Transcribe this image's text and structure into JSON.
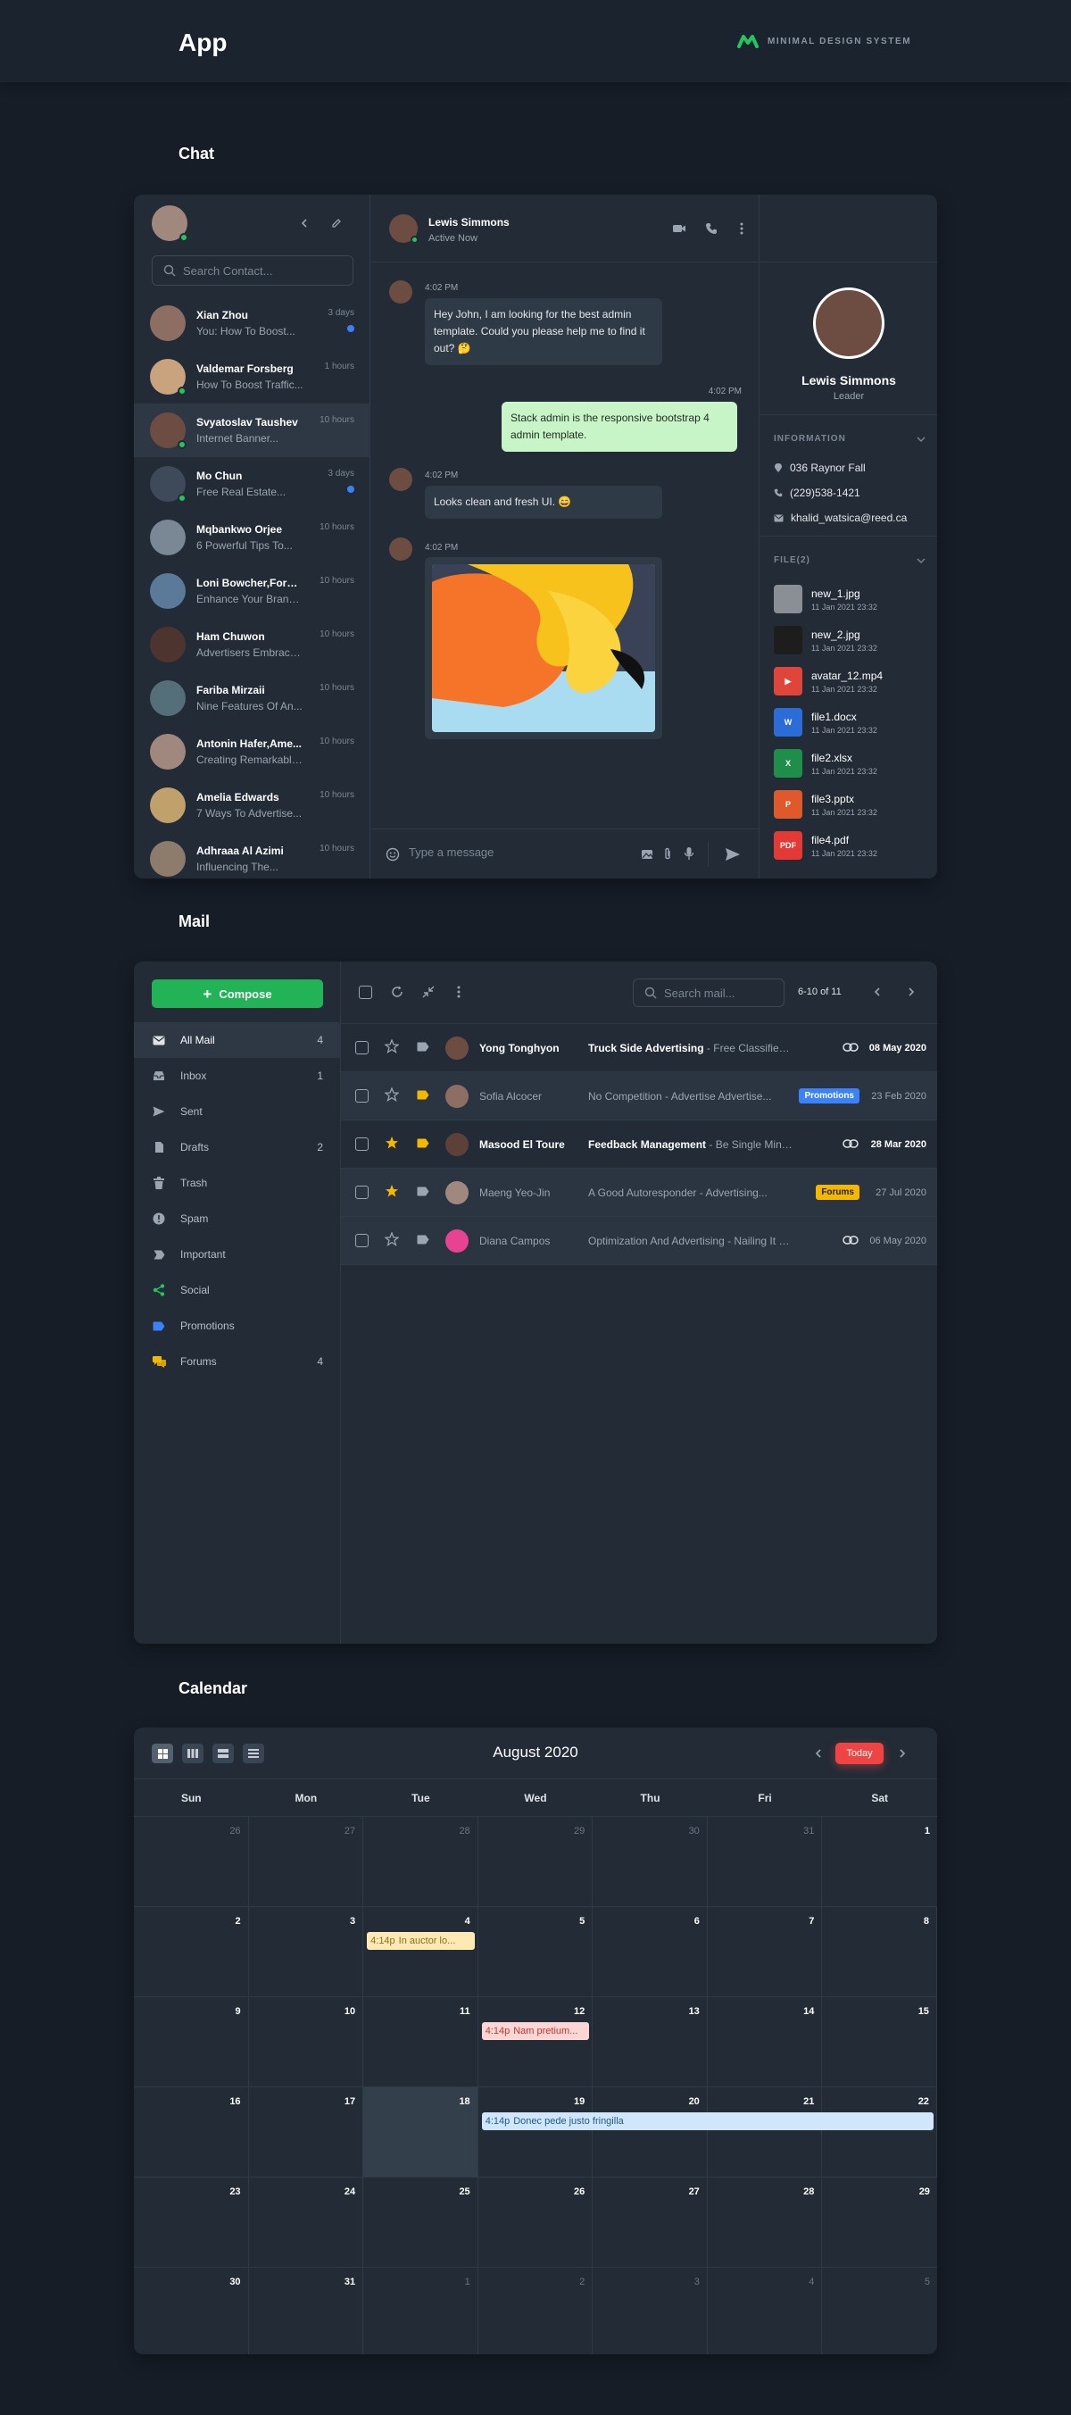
{
  "header": {
    "title": "App",
    "brand": "MINIMAL DESIGN SYSTEM",
    "brand_color": "#22c55e"
  },
  "chat": {
    "section_title": "Chat",
    "search_placeholder": "Search Contact...",
    "contacts": [
      {
        "name": "Xian Zhou",
        "message": "You: How To Boost...",
        "time": "3 days",
        "unread": true,
        "online": false,
        "color": "#8d6e63"
      },
      {
        "name": "Valdemar Forsberg",
        "message": "How To Boost Traffic...",
        "time": "1 hours",
        "unread": false,
        "online": true,
        "color": "#c9a27e"
      },
      {
        "name": "Svyatoslav Taushev",
        "message": "Internet Banner...",
        "time": "10 hours",
        "unread": false,
        "online": true,
        "color": "#6d4c41"
      },
      {
        "name": "Mo Chun",
        "message": "Free Real Estate...",
        "time": "3 days",
        "unread": true,
        "online": true,
        "color": "#3e4a5a"
      },
      {
        "name": "Mqbankwo Orjee",
        "message": "6 Powerful Tips To...",
        "time": "10 hours",
        "unread": false,
        "online": false,
        "color": "#7a8794"
      },
      {
        "name": "Loni Bowcher,Forsb...",
        "message": "Enhance Your Brand...",
        "time": "10 hours",
        "unread": false,
        "online": false,
        "color": "#5b7a99"
      },
      {
        "name": "Ham Chuwon",
        "message": "Advertisers Embrace...",
        "time": "10 hours",
        "unread": false,
        "online": false,
        "color": "#4e342e"
      },
      {
        "name": "Fariba Mirzaii",
        "message": "Nine Features Of An...",
        "time": "10 hours",
        "unread": false,
        "online": false,
        "color": "#546e7a"
      },
      {
        "name": "Antonin Hafer,Ame...",
        "message": "Creating Remarkable...",
        "time": "10 hours",
        "unread": false,
        "online": false,
        "color": "#a1887f"
      },
      {
        "name": "Amelia Edwards",
        "message": "7 Ways To Advertise...",
        "time": "10 hours",
        "unread": false,
        "online": false,
        "color": "#c0a16b"
      },
      {
        "name": "Adhraaa Al Azimi",
        "message": "Influencing The...",
        "time": "10 hours",
        "unread": false,
        "online": false,
        "color": "#8d7b6b"
      }
    ],
    "active_user": {
      "name": "Lewis Simmons",
      "status": "Active Now",
      "role": "Leader"
    },
    "messages": [
      {
        "time": "4:02 PM",
        "text": "Hey John, I am looking for the best admin template. Could you please help me to find it out? 🤔",
        "mine": false
      },
      {
        "time": "4:02 PM",
        "text": "Stack admin is the responsive bootstrap 4 admin template.",
        "mine": true
      },
      {
        "time": "4:02 PM",
        "text": "Looks clean and fresh UI. 😄",
        "mine": false
      },
      {
        "time": "4:02 PM",
        "text": "",
        "mine": false
      }
    ],
    "input_placeholder": "Type a message",
    "info_label": "INFORMATION",
    "info": {
      "address": "036 Raynor Fall",
      "phone": "(229)538-1421",
      "email": "khalid_watsica@reed.ca"
    },
    "files_label": "FILE(2)",
    "files": [
      {
        "name": "new_1.jpg",
        "date": "11 Jan 2021 23:32",
        "color": "#8a8f96",
        "label": ""
      },
      {
        "name": "new_2.jpg",
        "date": "11 Jan 2021 23:32",
        "color": "#1d1d1d",
        "label": ""
      },
      {
        "name": "avatar_12.mp4",
        "date": "11 Jan 2021 23:32",
        "color": "#e0453a",
        "label": "▶"
      },
      {
        "name": "file1.docx",
        "date": "11 Jan 2021 23:32",
        "color": "#2b6cd9",
        "label": "W"
      },
      {
        "name": "file2.xlsx",
        "date": "11 Jan 2021 23:32",
        "color": "#1e8e4a",
        "label": "X"
      },
      {
        "name": "file3.pptx",
        "date": "11 Jan 2021 23:32",
        "color": "#e0592a",
        "label": "P"
      },
      {
        "name": "file4.pdf",
        "date": "11 Jan 2021 23:32",
        "color": "#e53935",
        "label": "PDF"
      }
    ]
  },
  "mail": {
    "section_title": "Mail",
    "compose_label": "Compose",
    "search_placeholder": "Search mail...",
    "pagination": "6-10 of 11",
    "folders": [
      {
        "label": "All Mail",
        "count": "4",
        "icon": "mail-icon",
        "color": "#dfe3e8"
      },
      {
        "label": "Inbox",
        "count": "1",
        "icon": "inbox-icon",
        "color": "#9aa5b1"
      },
      {
        "label": "Sent",
        "count": "",
        "icon": "send-icon",
        "color": "#9aa5b1"
      },
      {
        "label": "Drafts",
        "count": "2",
        "icon": "draft-icon",
        "color": "#9aa5b1"
      },
      {
        "label": "Trash",
        "count": "",
        "icon": "trash-icon",
        "color": "#9aa5b1"
      },
      {
        "label": "Spam",
        "count": "",
        "icon": "spam-icon",
        "color": "#9aa5b1"
      },
      {
        "label": "Important",
        "count": "",
        "icon": "important-icon",
        "color": "#9aa5b1"
      },
      {
        "label": "Social",
        "count": "",
        "icon": "social-icon",
        "color": "#22c55e"
      },
      {
        "label": "Promotions",
        "count": "",
        "icon": "promotions-icon",
        "color": "#3b82f6"
      },
      {
        "label": "Forums",
        "count": "4",
        "icon": "forums-icon",
        "color": "#f5b800"
      }
    ],
    "rows": [
      {
        "sender": "Yong Tonghyon",
        "subject": "Truck Side Advertising",
        "preview": " - Free Classifieds Using...",
        "date": "08 May 2020",
        "read": false,
        "starred": false,
        "label_color": "#9aa5b1",
        "badge": "",
        "badge_color": "",
        "link": true,
        "avatar": "#6d4c41"
      },
      {
        "sender": "Sofia Alcocer",
        "subject": "No Competition",
        "preview": " - Advertise Advertise...",
        "date": "23 Feb 2020",
        "read": true,
        "starred": false,
        "label_color": "#f5b800",
        "badge": "Promotions",
        "badge_color": "#3b82f6",
        "link": false,
        "avatar": "#8d6e63"
      },
      {
        "sender": "Masood El Toure",
        "subject": "Feedback Management",
        "preview": " - Be Single Minded",
        "date": "28 Mar 2020",
        "read": false,
        "starred": true,
        "label_color": "#f5b800",
        "badge": "",
        "badge_color": "",
        "link": true,
        "avatar": "#5d4037"
      },
      {
        "sender": "Maeng Yeo-Jin",
        "subject": "A Good Autoresponder",
        "preview": " - Advertising...",
        "date": "27 Jul 2020",
        "read": true,
        "starred": true,
        "label_color": "#9aa5b1",
        "badge": "Forums",
        "badge_color": "#f5b800",
        "link": false,
        "avatar": "#a1887f"
      },
      {
        "sender": "Diana Campos",
        "subject": "Optimization And Advertising",
        "preview": " - Nailing It On The...",
        "date": "06 May 2020",
        "read": true,
        "starred": false,
        "label_color": "#9aa5b1",
        "badge": "",
        "badge_color": "",
        "link": true,
        "avatar": "#e84393"
      }
    ]
  },
  "calendar": {
    "section_title": "Calendar",
    "month": "August 2020",
    "today_label": "Today",
    "days_of_week": [
      "Sun",
      "Mon",
      "Tue",
      "Wed",
      "Thu",
      "Fri",
      "Sat"
    ],
    "weeks": [
      [
        {
          "d": "26",
          "o": true
        },
        {
          "d": "27",
          "o": true
        },
        {
          "d": "28",
          "o": true
        },
        {
          "d": "29",
          "o": true
        },
        {
          "d": "30",
          "o": true
        },
        {
          "d": "31",
          "o": true
        },
        {
          "d": "1",
          "o": false
        }
      ],
      [
        {
          "d": "2",
          "o": false
        },
        {
          "d": "3",
          "o": false
        },
        {
          "d": "4",
          "o": false
        },
        {
          "d": "5",
          "o": false
        },
        {
          "d": "6",
          "o": false
        },
        {
          "d": "7",
          "o": false
        },
        {
          "d": "8",
          "o": false
        }
      ],
      [
        {
          "d": "9",
          "o": false
        },
        {
          "d": "10",
          "o": false
        },
        {
          "d": "11",
          "o": false
        },
        {
          "d": "12",
          "o": false
        },
        {
          "d": "13",
          "o": false
        },
        {
          "d": "14",
          "o": false
        },
        {
          "d": "15",
          "o": false
        }
      ],
      [
        {
          "d": "16",
          "o": false
        },
        {
          "d": "17",
          "o": false
        },
        {
          "d": "18",
          "o": false,
          "today": true
        },
        {
          "d": "19",
          "o": false
        },
        {
          "d": "20",
          "o": false
        },
        {
          "d": "21",
          "o": false
        },
        {
          "d": "22",
          "o": false
        }
      ],
      [
        {
          "d": "23",
          "o": false
        },
        {
          "d": "24",
          "o": false
        },
        {
          "d": "25",
          "o": false
        },
        {
          "d": "26",
          "o": false
        },
        {
          "d": "27",
          "o": false
        },
        {
          "d": "28",
          "o": false
        },
        {
          "d": "29",
          "o": false
        }
      ],
      [
        {
          "d": "30",
          "o": false
        },
        {
          "d": "31",
          "o": false
        },
        {
          "d": "1",
          "o": true
        },
        {
          "d": "2",
          "o": true
        },
        {
          "d": "3",
          "o": true
        },
        {
          "d": "4",
          "o": true
        },
        {
          "d": "5",
          "o": true
        }
      ]
    ],
    "events": [
      {
        "time": "4:14p",
        "title": "In auctor lo...",
        "week": 1,
        "start": 2,
        "span": 1,
        "bg": "#fde9b3",
        "fg": "#8a6d1c"
      },
      {
        "time": "4:14p",
        "title": "Nam pretium...",
        "week": 2,
        "start": 3,
        "span": 1,
        "bg": "#fcd5d5",
        "fg": "#c0392b"
      },
      {
        "time": "4:14p",
        "title": "Donec pede justo fringilla",
        "week": 3,
        "start": 3,
        "span": 4,
        "bg": "#cfe6fb",
        "fg": "#1d5a91"
      }
    ]
  }
}
